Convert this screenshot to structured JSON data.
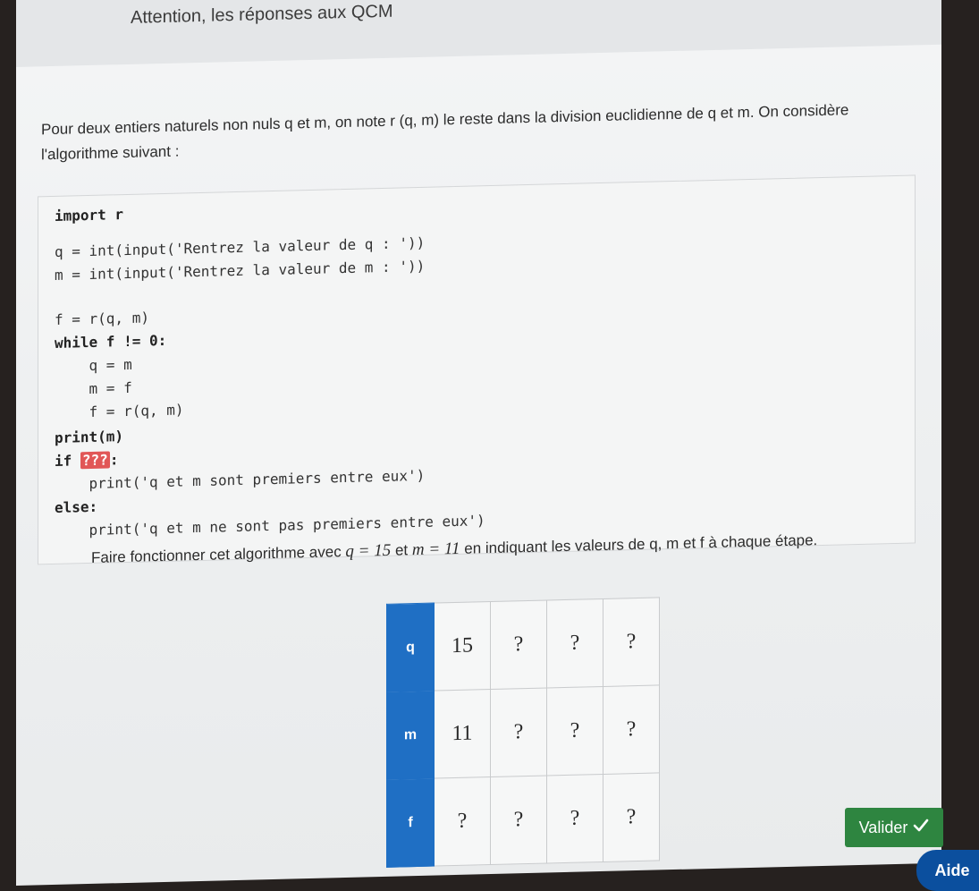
{
  "header": {
    "banner": "Attention, les réponses aux QCM"
  },
  "intro": {
    "text": "Pour deux entiers naturels non nuls q et m, on note r (q, m) le reste dans la division euclidienne de q et m. On considère l'algorithme suivant :"
  },
  "code": {
    "lines": [
      "import r",
      "q = int(input('Rentrez la valeur de q : '))",
      "m = int(input('Rentrez la valeur de m : '))",
      "f = r(q, m)",
      "while f != 0:",
      "    q = m",
      "    m = f",
      "    f = r(q, m)",
      "print(m)",
      "if ???:",
      "    print('q et m sont premiers entre eux')",
      "else:",
      "    print('q et m ne sont pas premiers entre eux')"
    ],
    "blank": "???"
  },
  "instruction": {
    "prefix": "Faire fonctionner cet algorithme avec ",
    "q_expr": "q = 15",
    "mid": " et ",
    "m_expr": "m = 11",
    "suffix": " en indiquant les valeurs de q, m et f à chaque étape."
  },
  "table": {
    "rows": [
      {
        "label": "q",
        "cells": [
          "15",
          "?",
          "?",
          "?"
        ]
      },
      {
        "label": "m",
        "cells": [
          "11",
          "?",
          "?",
          "?"
        ]
      },
      {
        "label": "f",
        "cells": [
          "?",
          "?",
          "?",
          "?"
        ]
      }
    ]
  },
  "buttons": {
    "valider": "Valider",
    "valider_icon": "checkmark-icon",
    "aide": "Aide"
  },
  "colors": {
    "accent": "#1f6fc4",
    "valider": "#2e8540",
    "aide": "#0b4f9e",
    "blank": "#e15757"
  }
}
